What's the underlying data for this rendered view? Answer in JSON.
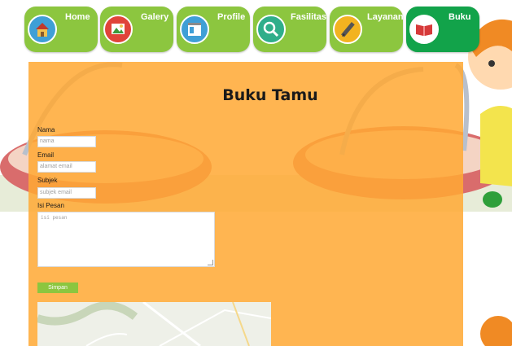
{
  "nav": {
    "items": [
      {
        "label": "Home",
        "icon": "house-icon"
      },
      {
        "label": "Galery",
        "icon": "picture-icon"
      },
      {
        "label": "Profile",
        "icon": "window-icon"
      },
      {
        "label": "Fasilitas",
        "icon": "magnifier-icon"
      },
      {
        "label": "Layanan",
        "icon": "pencil-icon"
      },
      {
        "label": "Buku",
        "icon": "book-icon"
      }
    ],
    "active_index": 5
  },
  "colors": {
    "nav_green": "#8cc63f",
    "nav_active": "#12a34a",
    "panel_orange": "#ffa934",
    "button_green": "#8cc63f"
  },
  "form": {
    "title": "Buku Tamu",
    "name_label": "Nama",
    "name_placeholder": "nama",
    "email_label": "Email",
    "email_placeholder": "alamat email",
    "subject_label": "Subjek",
    "subject_placeholder": "subjek email",
    "message_label": "Isi Pesan",
    "message_placeholder": "isi pesan",
    "submit_label": "Simpan"
  }
}
